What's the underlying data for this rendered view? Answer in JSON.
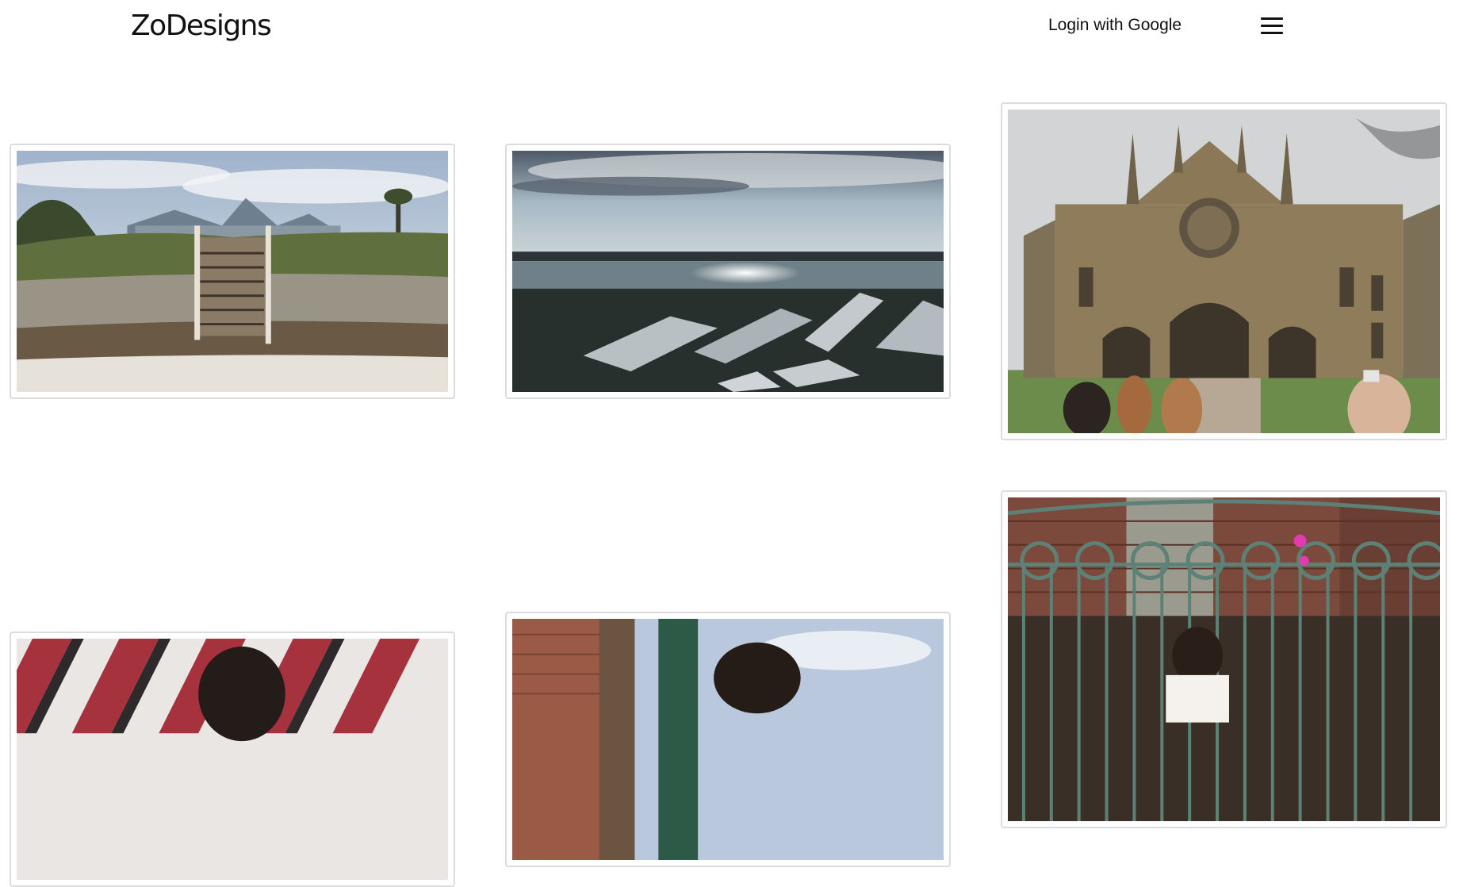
{
  "header": {
    "logo": "ZoDesigns",
    "login_label": "Login with Google"
  },
  "icons": {
    "menu": "hamburger-menu-icon"
  },
  "gallery": {
    "photos": [
      {
        "subject": "beach-stairs-photo"
      },
      {
        "subject": "lake-sunset-aerial-photo"
      },
      {
        "subject": "gothic-cathedral-photo"
      },
      {
        "subject": "striped-wall-portrait-photo"
      },
      {
        "subject": "tree-brick-portrait-photo"
      },
      {
        "subject": "iron-gate-portrait-photo"
      }
    ]
  }
}
